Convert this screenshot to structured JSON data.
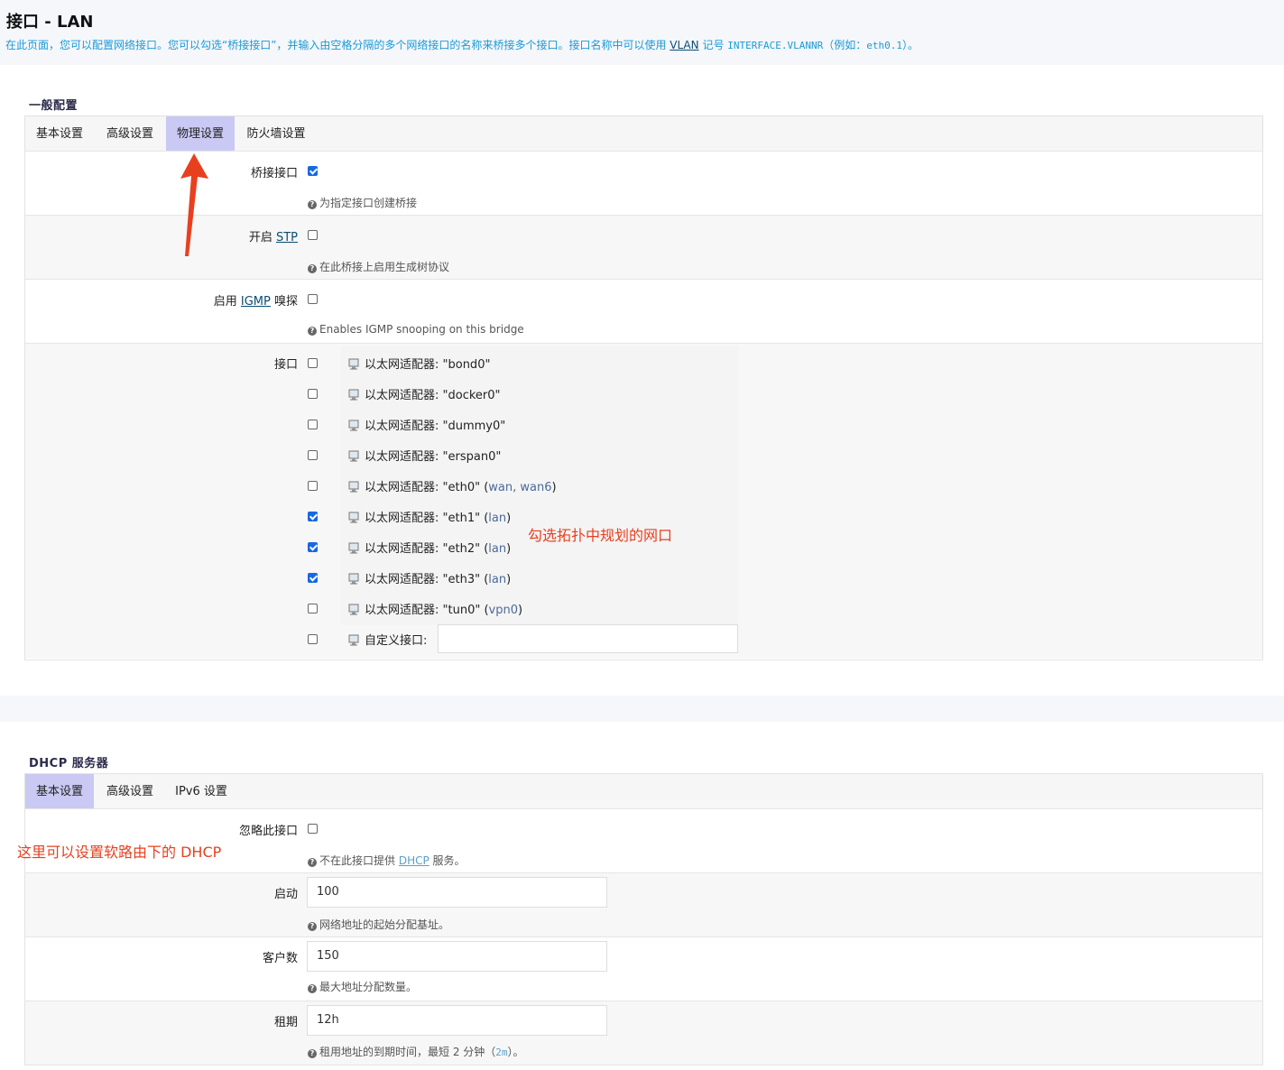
{
  "header": {
    "title": "接口 - LAN",
    "desc_part1": "在此页面，您可以配置网络接口。您可以勾选“桥接接口”，并输入由空格分隔的多个网络接口的名称来桥接多个接口。接口名称中可以使用 ",
    "desc_vlan": "VLAN",
    "desc_part2": " 记号 ",
    "desc_code": "INTERFACE.VLANNR",
    "desc_part3": "（例如：",
    "desc_example": "eth0.1",
    "desc_part4": "）。"
  },
  "general": {
    "section_title": "一般配置",
    "tabs": [
      {
        "label": "基本设置",
        "active": false
      },
      {
        "label": "高级设置",
        "active": false
      },
      {
        "label": "物理设置",
        "active": true
      },
      {
        "label": "防火墙设置",
        "active": false
      }
    ],
    "bridge": {
      "label": "桥接接口",
      "checked": true,
      "help": "为指定接口创建桥接"
    },
    "stp": {
      "label_pre": "开启 ",
      "label_link": "STP",
      "checked": false,
      "help": "在此桥接上启用生成树协议"
    },
    "igmp": {
      "label_pre": "启用 ",
      "label_link": "IGMP",
      "label_post": " 嗅探",
      "checked": false,
      "help": "Enables IGMP snooping on this bridge"
    },
    "interfaces_label": "接口",
    "interfaces": [
      {
        "name": "以太网适配器: \"bond0\"",
        "zone": "",
        "checked": false
      },
      {
        "name": "以太网适配器: \"docker0\"",
        "zone": "",
        "checked": false
      },
      {
        "name": "以太网适配器: \"dummy0\"",
        "zone": "",
        "checked": false
      },
      {
        "name": "以太网适配器: \"erspan0\"",
        "zone": "",
        "checked": false
      },
      {
        "name": "以太网适配器: \"eth0\" (",
        "zone": "wan, wan6",
        "checked": false
      },
      {
        "name": "以太网适配器: \"eth1\" (",
        "zone": "lan",
        "checked": true
      },
      {
        "name": "以太网适配器: \"eth2\" (",
        "zone": "lan",
        "checked": true
      },
      {
        "name": "以太网适配器: \"eth3\" (",
        "zone": "lan",
        "checked": true
      },
      {
        "name": "以太网适配器: \"tun0\" (",
        "zone": "vpn0",
        "checked": false
      }
    ],
    "custom_label": "自定义接口:",
    "custom_value": ""
  },
  "annotations": {
    "ports": "勾选拓扑中规划的网口",
    "dhcp": "这里可以设置软路由下的 DHCP"
  },
  "dhcp": {
    "section_title": "DHCP 服务器",
    "tabs": [
      {
        "label": "基本设置",
        "active": true
      },
      {
        "label": "高级设置",
        "active": false
      },
      {
        "label": "IPv6 设置",
        "active": false
      }
    ],
    "ignore": {
      "label": "忽略此接口",
      "checked": false,
      "help_pre": "不在此接口提供 ",
      "help_link": "DHCP",
      "help_post": " 服务。"
    },
    "start": {
      "label": "启动",
      "value": "100",
      "help": "网络地址的起始分配基址。"
    },
    "limit": {
      "label": "客户数",
      "value": "150",
      "help": "最大地址分配数量。"
    },
    "lease": {
      "label": "租期",
      "value": "12h",
      "help_pre": "租用地址的到期时间，最短 2 分钟（",
      "help_code": "2m",
      "help_post": "）。"
    }
  },
  "colors": {
    "accent_tab": "#c9c9f4",
    "checkbox_checked": "#1768e3",
    "annotation": "#e8401f",
    "desc_text": "#1a9ad6"
  }
}
